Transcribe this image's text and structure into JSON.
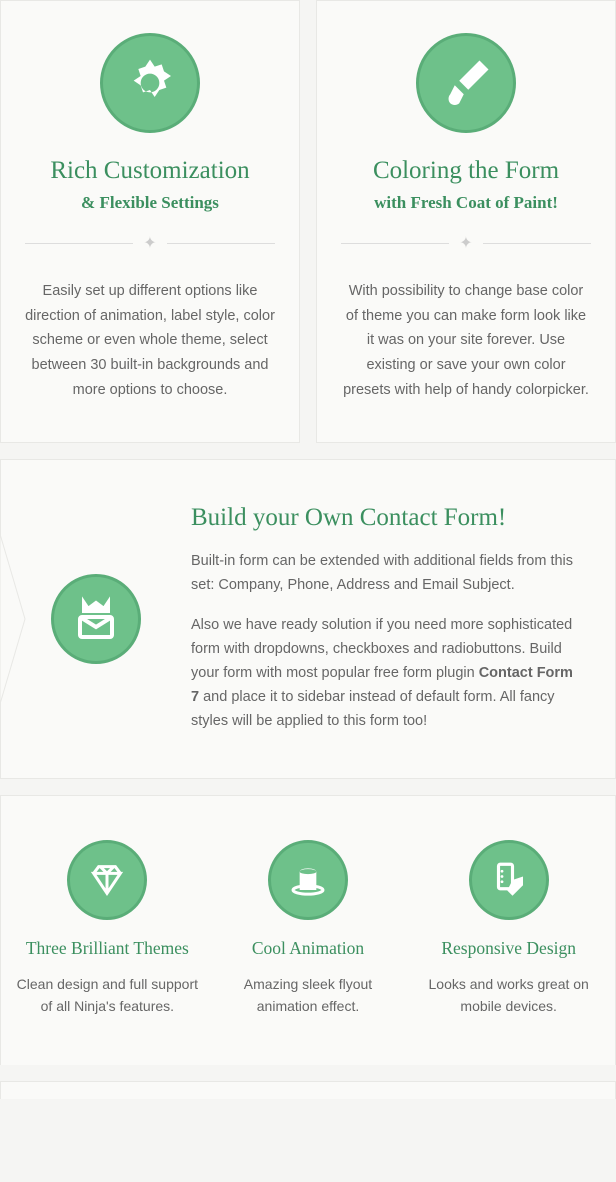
{
  "cards": [
    {
      "title": "Rich Customization",
      "subtitle": "& Flexible Settings",
      "body": "Easily set up different options like direction of animation, label style, color scheme or even whole theme, select between 30 built-in backgrounds and more options to choose."
    },
    {
      "title": "Coloring the Form",
      "subtitle": "with Fresh Coat of Paint!",
      "body": "With possibility to change base color of theme you can make form look like it was on your site forever. Use existing or save your own color presets with help of handy colorpicker."
    }
  ],
  "build": {
    "title": "Build your Own Contact Form!",
    "p1": "Built-in form can be extended with additional fields from this set: Company, Phone,  Address and Email Subject.",
    "p2a": "Also we have ready solution if you need more sophisticated form with dropdowns, checkboxes and radiobuttons. Build your form with most popular free form plugin ",
    "p2bold": "Contact Form 7",
    "p2b": "  and place it to sidebar instead of default form. All fancy styles will be applied to this form too!"
  },
  "minis": [
    {
      "title": "Three Brilliant Themes",
      "body": "Clean design and full support of all Ninja's features."
    },
    {
      "title": "Cool Animation",
      "body": "Amazing sleek flyout animation effect."
    },
    {
      "title": "Responsive Design",
      "body": "Looks and works great on mobile devices."
    }
  ]
}
